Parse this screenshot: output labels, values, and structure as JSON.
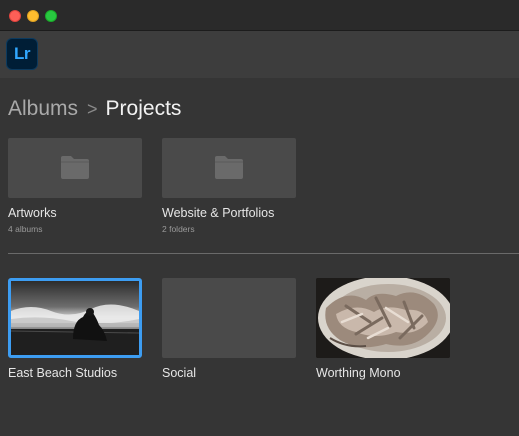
{
  "window": {
    "controls": [
      "close",
      "minimize",
      "zoom"
    ]
  },
  "app": {
    "logo_text": "Lr",
    "logo_color": "#31a8ff",
    "logo_bg": "#001e36"
  },
  "breadcrumb": {
    "parent": "Albums",
    "separator": ">",
    "current": "Projects"
  },
  "folders": [
    {
      "name": "Artworks",
      "count": "4 albums",
      "icon": "folder-icon"
    },
    {
      "name": "Website & Portfolios",
      "count": "2 folders",
      "icon": "folder-icon"
    }
  ],
  "albums": [
    {
      "name": "East Beach Studios",
      "selected": true,
      "thumbnail": "black-and-white figure on beach"
    },
    {
      "name": "Social",
      "selected": false,
      "thumbnail": "empty"
    },
    {
      "name": "Worthing Mono",
      "selected": false,
      "thumbnail": "food on plate"
    }
  ],
  "colors": {
    "selection": "#3d9df2",
    "background": "#353535"
  }
}
